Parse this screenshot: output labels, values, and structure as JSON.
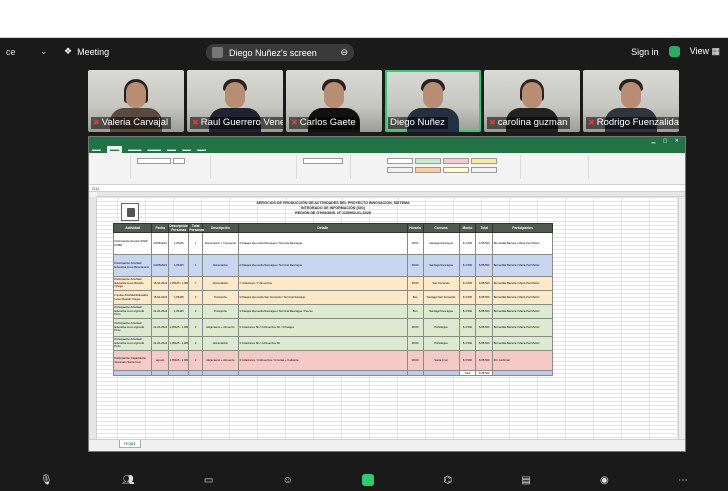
{
  "zoom": {
    "left_fragment": "ce",
    "meeting_label": "Meeting",
    "share_label": "Diego Nuñez's screen",
    "signin_label": "Sign in",
    "view_label": "View"
  },
  "participants": [
    {
      "name": "Valeria Carvajal"
    },
    {
      "name": "Raul Guerrero Venegas"
    },
    {
      "name": "Carlos Gaete"
    },
    {
      "name": "Diego Nuñez"
    },
    {
      "name": "carolina guzman"
    },
    {
      "name": "Rodrigo Fuenzalida"
    }
  ],
  "excel": {
    "sheet_tab": "Hoja1",
    "cell_ref": "G11",
    "report_title_1": "SERVICIOS DE PRODUCCIÓN DE ACTIVIDADES DEL PROYECTO INNOVACIÓN, SISTEMA",
    "report_title_2": "INTEGRADO DE INFORMACIÓN (SIG)",
    "report_title_3": "REGIÓN DE O'HIGGINS. Nº 1150502-01-A025",
    "headers": [
      "Actividad",
      "Fecha",
      "Descripción Personas",
      "Total Personas",
      "Descripción",
      "Detalle",
      "Horario",
      "Comuna",
      "Monto",
      "Total",
      "Participantes"
    ],
    "rows": [
      [
        "Participación Escolar SOEP ROBR",
        "04/05/2024",
        "1,05425",
        "1",
        "Alimentación + Transporte",
        "3 Pasajes ida-vuelta Rancagua / Terminal Rancagua",
        "08:00",
        "Santiago Rancagua",
        "$ 3.500",
        "$ 88.500",
        "Bernardita Barraza / María Paz Muñoz"
      ],
      [
        "Participación Actividad Educativa Liceo Bicentenario",
        "04/05/2024",
        "1,05425",
        "1",
        "Alimentación",
        "2 Pasajes ida-vuelta Rancagua / Terminal Rancagua",
        "08:00",
        "Santiago Rancagua",
        "$ 3.500",
        "$ 88.500",
        "Bernardita Barraza / María Paz Muñoz"
      ],
      [
        "Participación Actividad Educativa Liceo Ricardo Ortega",
        "18-04-2024",
        "1,05425 - 1,081",
        "7",
        "Alimentación",
        "7 Colaciones / 7 Almuerzos",
        "08:00",
        "San Fernando",
        "$ 3.500",
        "$ 88.500",
        "Bernardita Barraza / María Paz Muñoz"
      ],
      [
        "Impulso Actividad Educativa Liceo Ricardo Ortega",
        "18-04-2024",
        "1,05425",
        "3",
        "Transporte",
        "3 Pasajes ida-vuelta San Fernando / Terminal Santiago",
        "Bus",
        "Santiago San Fernando",
        "$ 3.500",
        "$ 88.500",
        "Bernardita Barraza / María Paz Muñoz"
      ],
      [
        "Participación Actividad Educativa Liceo Agrícola Pozo",
        "24-04-2024",
        "1,05425",
        "3",
        "Transporte",
        "3 Pasajes ida-vuelta Rancagua / Terminal Rancagua / Peumo",
        "Bus",
        "Santiago Rancagua",
        "$ 3.500",
        "$ 88.500",
        "Bernardita Barraza / María Paz Muñoz"
      ],
      [
        "Participación Actividad Educativa Liceo Agrícola Pozo",
        "24-04-2024",
        "1,05425 - 1,081",
        "3",
        "Alojamiento + Almuerzo",
        "3 Colaciones SII / 3 Almuerzos SII / 3 Pasajes",
        "08:00",
        "Pichidegua",
        "$ 3.500",
        "$ 88.500",
        "Bernardita Barraza / María Paz Muñoz"
      ],
      [
        "Participación Actividad Educativa Liceo Agrícola Pozo",
        "24-04-2024",
        "1,05425 - 1,081",
        "3",
        "Alimentación",
        "3 Colaciones SII / 3 Almuerzos SII",
        "08:00",
        "Pichidegua",
        "$ 3.500",
        "$ 88.500",
        "Bernardita Barraza / María Paz Muñoz"
      ],
      [
        "Participación Capacitación Seminario Santa Cruz",
        "agosto",
        "1,05425 - 1,081",
        "3",
        "Alojamiento + Almuerzo",
        "3 Colaciones / 3 Almuerzos / 3 Cenas + Cafetería",
        "08:00",
        "Santa Cruz",
        "$ 3.500",
        "$ 88.500",
        "Por confirmar"
      ]
    ],
    "row_colors": [
      "#ffffff",
      "#c9d6ef",
      "#fde9c8",
      "#fde9c8",
      "#dcead0",
      "#dcead0",
      "#dcead0",
      "#f6c9c9"
    ],
    "total_label": "Total",
    "total_value": "$ 88.500"
  },
  "colors": {
    "excel_green": "#217346",
    "zoom_bg": "#1a1a1a",
    "active_speaker": "#2ecc71",
    "header_bg": "#4d5a4d"
  }
}
